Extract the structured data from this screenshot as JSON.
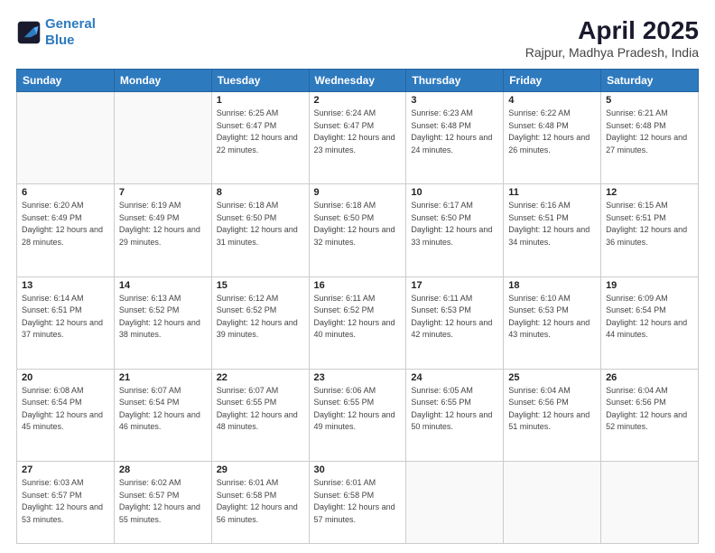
{
  "header": {
    "logo_line1": "General",
    "logo_line2": "Blue",
    "title": "April 2025",
    "subtitle": "Rajpur, Madhya Pradesh, India"
  },
  "weekdays": [
    "Sunday",
    "Monday",
    "Tuesday",
    "Wednesday",
    "Thursday",
    "Friday",
    "Saturday"
  ],
  "weeks": [
    [
      {
        "day": "",
        "info": ""
      },
      {
        "day": "",
        "info": ""
      },
      {
        "day": "1",
        "info": "Sunrise: 6:25 AM\nSunset: 6:47 PM\nDaylight: 12 hours and 22 minutes."
      },
      {
        "day": "2",
        "info": "Sunrise: 6:24 AM\nSunset: 6:47 PM\nDaylight: 12 hours and 23 minutes."
      },
      {
        "day": "3",
        "info": "Sunrise: 6:23 AM\nSunset: 6:48 PM\nDaylight: 12 hours and 24 minutes."
      },
      {
        "day": "4",
        "info": "Sunrise: 6:22 AM\nSunset: 6:48 PM\nDaylight: 12 hours and 26 minutes."
      },
      {
        "day": "5",
        "info": "Sunrise: 6:21 AM\nSunset: 6:48 PM\nDaylight: 12 hours and 27 minutes."
      }
    ],
    [
      {
        "day": "6",
        "info": "Sunrise: 6:20 AM\nSunset: 6:49 PM\nDaylight: 12 hours and 28 minutes."
      },
      {
        "day": "7",
        "info": "Sunrise: 6:19 AM\nSunset: 6:49 PM\nDaylight: 12 hours and 29 minutes."
      },
      {
        "day": "8",
        "info": "Sunrise: 6:18 AM\nSunset: 6:50 PM\nDaylight: 12 hours and 31 minutes."
      },
      {
        "day": "9",
        "info": "Sunrise: 6:18 AM\nSunset: 6:50 PM\nDaylight: 12 hours and 32 minutes."
      },
      {
        "day": "10",
        "info": "Sunrise: 6:17 AM\nSunset: 6:50 PM\nDaylight: 12 hours and 33 minutes."
      },
      {
        "day": "11",
        "info": "Sunrise: 6:16 AM\nSunset: 6:51 PM\nDaylight: 12 hours and 34 minutes."
      },
      {
        "day": "12",
        "info": "Sunrise: 6:15 AM\nSunset: 6:51 PM\nDaylight: 12 hours and 36 minutes."
      }
    ],
    [
      {
        "day": "13",
        "info": "Sunrise: 6:14 AM\nSunset: 6:51 PM\nDaylight: 12 hours and 37 minutes."
      },
      {
        "day": "14",
        "info": "Sunrise: 6:13 AM\nSunset: 6:52 PM\nDaylight: 12 hours and 38 minutes."
      },
      {
        "day": "15",
        "info": "Sunrise: 6:12 AM\nSunset: 6:52 PM\nDaylight: 12 hours and 39 minutes."
      },
      {
        "day": "16",
        "info": "Sunrise: 6:11 AM\nSunset: 6:52 PM\nDaylight: 12 hours and 40 minutes."
      },
      {
        "day": "17",
        "info": "Sunrise: 6:11 AM\nSunset: 6:53 PM\nDaylight: 12 hours and 42 minutes."
      },
      {
        "day": "18",
        "info": "Sunrise: 6:10 AM\nSunset: 6:53 PM\nDaylight: 12 hours and 43 minutes."
      },
      {
        "day": "19",
        "info": "Sunrise: 6:09 AM\nSunset: 6:54 PM\nDaylight: 12 hours and 44 minutes."
      }
    ],
    [
      {
        "day": "20",
        "info": "Sunrise: 6:08 AM\nSunset: 6:54 PM\nDaylight: 12 hours and 45 minutes."
      },
      {
        "day": "21",
        "info": "Sunrise: 6:07 AM\nSunset: 6:54 PM\nDaylight: 12 hours and 46 minutes."
      },
      {
        "day": "22",
        "info": "Sunrise: 6:07 AM\nSunset: 6:55 PM\nDaylight: 12 hours and 48 minutes."
      },
      {
        "day": "23",
        "info": "Sunrise: 6:06 AM\nSunset: 6:55 PM\nDaylight: 12 hours and 49 minutes."
      },
      {
        "day": "24",
        "info": "Sunrise: 6:05 AM\nSunset: 6:55 PM\nDaylight: 12 hours and 50 minutes."
      },
      {
        "day": "25",
        "info": "Sunrise: 6:04 AM\nSunset: 6:56 PM\nDaylight: 12 hours and 51 minutes."
      },
      {
        "day": "26",
        "info": "Sunrise: 6:04 AM\nSunset: 6:56 PM\nDaylight: 12 hours and 52 minutes."
      }
    ],
    [
      {
        "day": "27",
        "info": "Sunrise: 6:03 AM\nSunset: 6:57 PM\nDaylight: 12 hours and 53 minutes."
      },
      {
        "day": "28",
        "info": "Sunrise: 6:02 AM\nSunset: 6:57 PM\nDaylight: 12 hours and 55 minutes."
      },
      {
        "day": "29",
        "info": "Sunrise: 6:01 AM\nSunset: 6:58 PM\nDaylight: 12 hours and 56 minutes."
      },
      {
        "day": "30",
        "info": "Sunrise: 6:01 AM\nSunset: 6:58 PM\nDaylight: 12 hours and 57 minutes."
      },
      {
        "day": "",
        "info": ""
      },
      {
        "day": "",
        "info": ""
      },
      {
        "day": "",
        "info": ""
      }
    ]
  ]
}
